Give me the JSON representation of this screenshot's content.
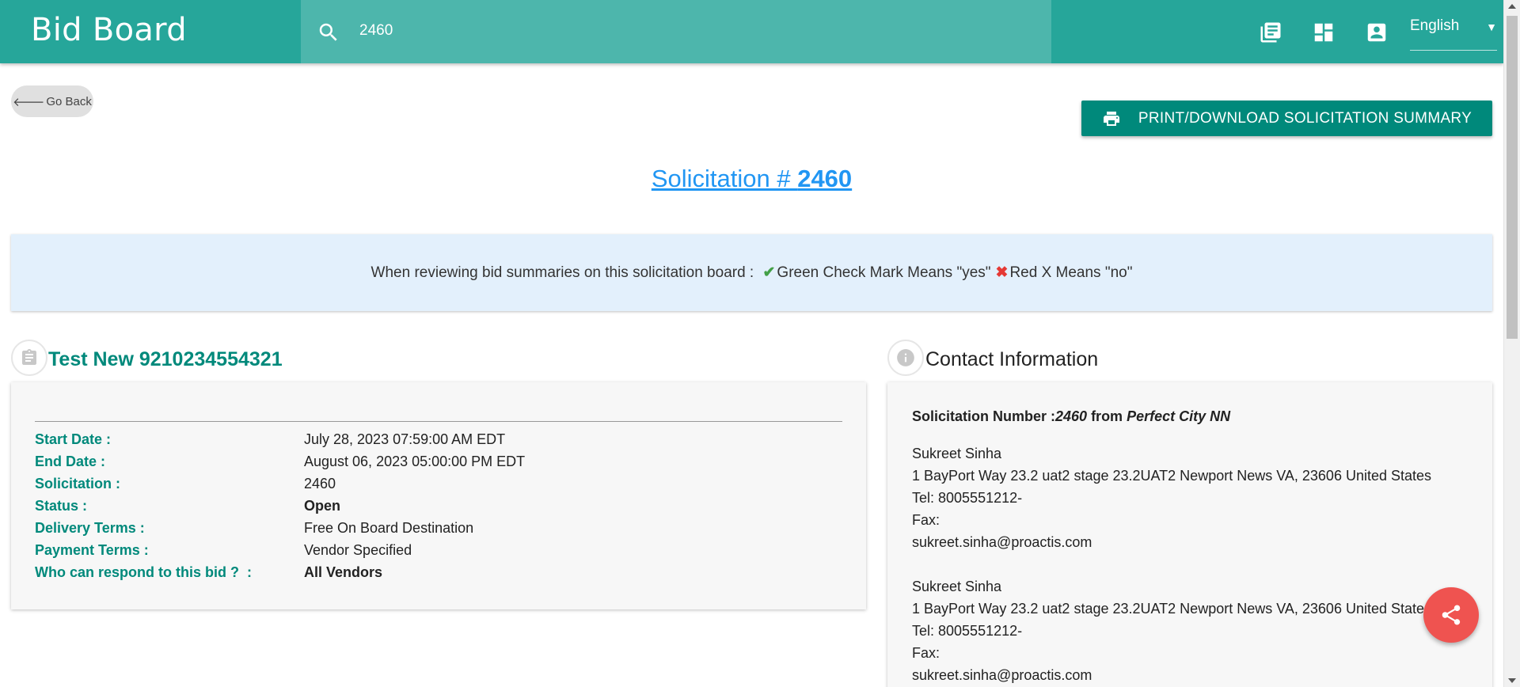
{
  "header": {
    "brand": "Bid Board",
    "search_value": "2460",
    "language": "English",
    "icons": [
      "library-books-icon",
      "dashboard-icon",
      "account-box-icon"
    ]
  },
  "nav": {
    "go_back": "Go Back",
    "print_button": "PRINT/DOWNLOAD SOLICITATION SUMMARY"
  },
  "solicitation": {
    "title_prefix": "Solicitation # ",
    "number": "2460"
  },
  "notice": {
    "lead": "When reviewing bid summaries on this solicitation board : ",
    "check_text": "Green Check Mark Means \"yes\"",
    "x_text": "Red X Means \"no\""
  },
  "details": {
    "title": "Test New 9210234554321",
    "rows": [
      {
        "label": "Start Date :",
        "value": "July 28, 2023 07:59:00 AM EDT"
      },
      {
        "label": "End Date :",
        "value": "August 06, 2023 05:00:00 PM EDT"
      },
      {
        "label": "Solicitation :",
        "value": "2460"
      },
      {
        "label": "Status :",
        "value": "Open"
      },
      {
        "label": "Delivery Terms :",
        "value": "Free On Board Destination"
      },
      {
        "label": "Payment Terms :",
        "value": "Vendor Specified"
      },
      {
        "label": "Who can respond to this bid ?  :",
        "value": "All Vendors"
      }
    ]
  },
  "contact": {
    "title": "Contact Information",
    "head_label": "Solicitation Number :",
    "head_number": "2460",
    "head_from": " from ",
    "head_org": "Perfect City NN",
    "contacts": [
      {
        "name": "Sukreet Sinha",
        "address": "1 BayPort Way 23.2 uat2 stage 23.2UAT2 Newport News VA, 23606 United States",
        "tel": "Tel: 8005551212-",
        "fax": "Fax:",
        "email": "sukreet.sinha@proactis.com"
      },
      {
        "name": "Sukreet Sinha",
        "address": "1 BayPort Way 23.2 uat2 stage 23.2UAT2 Newport News VA, 23606 United States",
        "tel": "Tel: 8005551212-",
        "fax": "Fax:",
        "email": "sukreet.sinha@proactis.com"
      }
    ]
  },
  "colors": {
    "primary": "#26a69a",
    "primary_dark": "#00897b",
    "link": "#2196f3",
    "notice_bg": "#e3f0fc",
    "fab": "#ef5350"
  }
}
